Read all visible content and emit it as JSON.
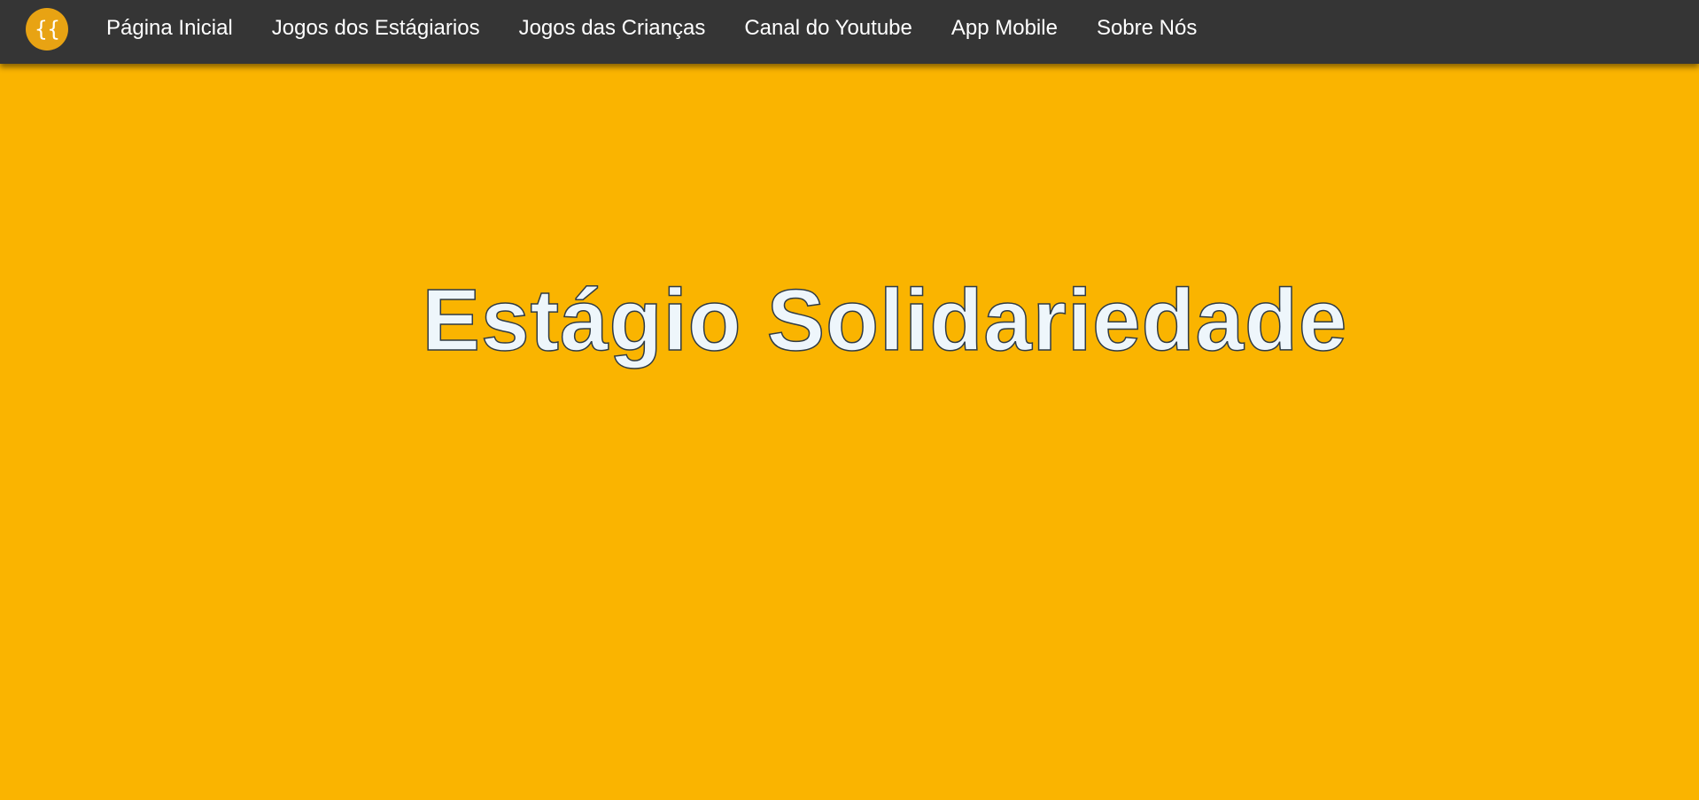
{
  "nav": {
    "logo_text": "{{",
    "links": [
      {
        "label": "Página Inicial"
      },
      {
        "label": "Jogos dos Estágiarios"
      },
      {
        "label": "Jogos das Crianças"
      },
      {
        "label": "Canal do Youtube"
      },
      {
        "label": "App Mobile"
      },
      {
        "label": "Sobre Nós"
      }
    ]
  },
  "hero": {
    "title": "Estágio Solidariedade"
  },
  "colors": {
    "background": "#FAB400",
    "navbar": "#353535",
    "logo_circle": "#E8A313",
    "title_fill": "#EEF6FB",
    "title_stroke": "#2F3B45"
  }
}
